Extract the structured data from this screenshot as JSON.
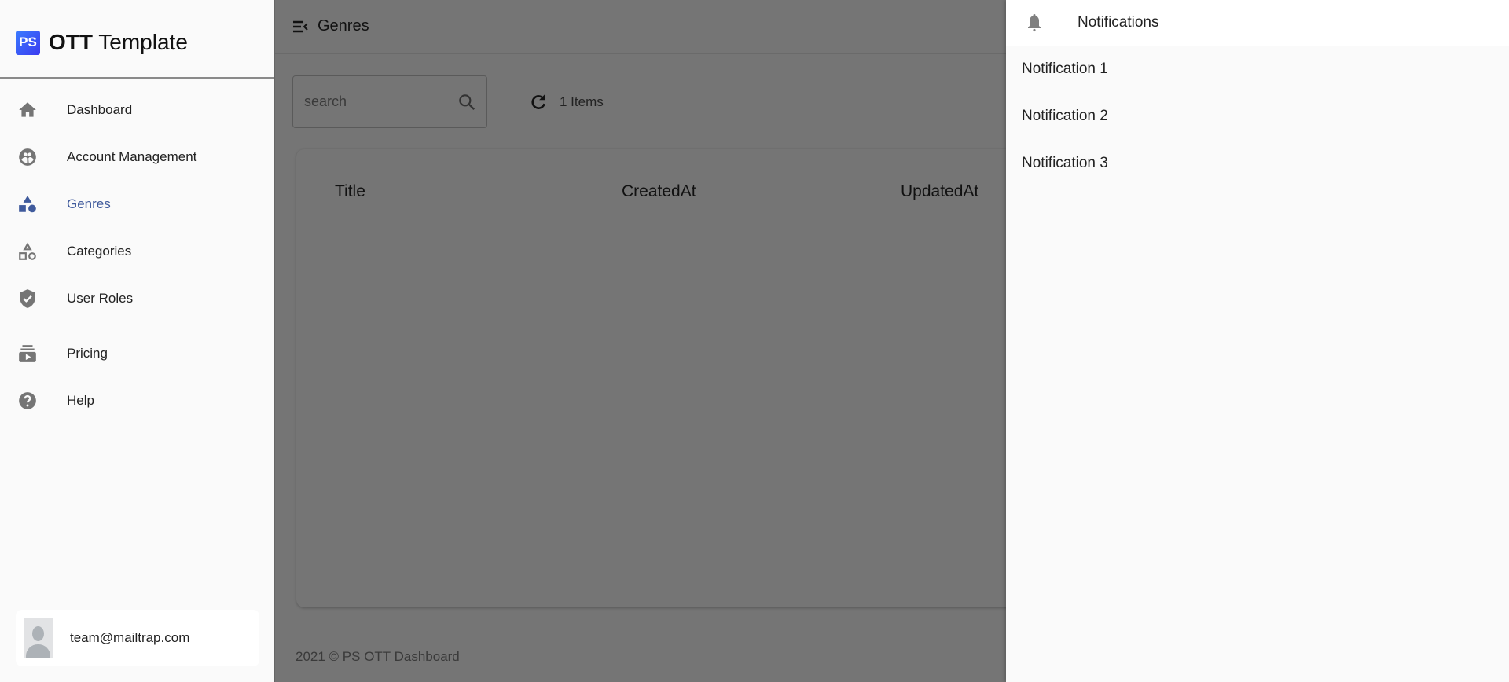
{
  "app": {
    "logo_badge": "PS",
    "logo_bold": "OTT",
    "logo_rest": "Template"
  },
  "sidebar": {
    "items": [
      {
        "label": "Dashboard",
        "icon": "home-icon"
      },
      {
        "label": "Account Management",
        "icon": "account-group-icon"
      },
      {
        "label": "Genres",
        "icon": "shapes-icon",
        "active": true
      },
      {
        "label": "Categories",
        "icon": "shapes-outline-icon"
      },
      {
        "label": "User Roles",
        "icon": "shield-check-icon"
      },
      {
        "label": "Pricing",
        "icon": "subscriptions-icon"
      },
      {
        "label": "Help",
        "icon": "help-circle-icon"
      }
    ],
    "user_email": "team@mailtrap.com"
  },
  "header": {
    "title": "Genres"
  },
  "toolbar": {
    "search_placeholder": "search",
    "items_count": "1 Items"
  },
  "table": {
    "columns": [
      "Title",
      "CreatedAt",
      "UpdatedAt"
    ]
  },
  "footer": {
    "text": "2021 © PS OTT Dashboard"
  },
  "notifications": {
    "title": "Notifications",
    "items": [
      "Notification 1",
      "Notification 2",
      "Notification 3"
    ]
  },
  "colors": {
    "accent": "#3f5a9c",
    "overlay": "#757575",
    "sidebar_bg": "#fafafa"
  }
}
